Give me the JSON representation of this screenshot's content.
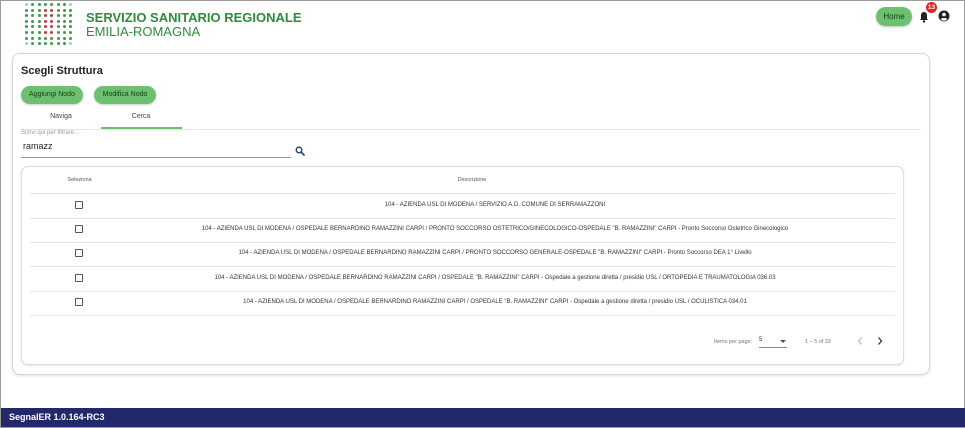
{
  "header": {
    "brand_line1": "SERVIZIO SANITARIO REGIONALE",
    "brand_line2": "EMILIA-ROMAGNA",
    "home_label": "Home",
    "notification_count": "13",
    "colors": {
      "brand": "#2e8b3c",
      "accent": "#6cc070",
      "badge": "#e02424"
    },
    "icons": [
      "bell-icon",
      "account-icon"
    ]
  },
  "card": {
    "title": "Scegli Struttura",
    "buttons": {
      "add_node": "Aggiungi Nodo",
      "edit_node": "Modifica Nodo"
    },
    "tabs": [
      {
        "label": "Naviga",
        "active": false
      },
      {
        "label": "Cerca",
        "active": true
      }
    ],
    "filter": {
      "label": "Scrivi qui per filtrare...",
      "value": "ramazz"
    }
  },
  "table": {
    "headers": {
      "select": "Seleziona",
      "description": "Descrizione"
    },
    "rows": [
      {
        "checked": false,
        "description": "104 - AZIENDA USL DI MODENA / SERVIZIO A.D. COMUNE DI SERRAMAZZONI"
      },
      {
        "checked": false,
        "description": "104 - AZIENDA USL DI MODENA / OSPEDALE BERNARDINO RAMAZZINI CARPI / PRONTO SOCCORSO OSTETRICO/GINECOLOGICO-OSPEDALE \"B. RAMAZZINI\" CARPI - Pronto Soccorso Ostetrico Ginecologico"
      },
      {
        "checked": false,
        "description": "104 - AZIENDA USL DI MODENA / OSPEDALE BERNARDINO RAMAZZINI CARPI / PRONTO SOCCORSO GENERALE-OSPEDALE  \"B. RAMAZZINI\"  CARPI - Pronto Soccorso DEA 1° Livello"
      },
      {
        "checked": false,
        "description": "104 - AZIENDA USL DI MODENA / OSPEDALE BERNARDINO RAMAZZINI CARPI / OSPEDALE \"B. RAMAZZINI\" CARPI - Ospedale a gestione diretta / presidio USL / ORTOPEDIA E TRAUMATOLOGIA 036.03"
      },
      {
        "checked": false,
        "description": "104 - AZIENDA USL DI MODENA / OSPEDALE BERNARDINO RAMAZZINI CARPI / OSPEDALE \"B. RAMAZZINI\" CARPI - Ospedale a gestione diretta / presidio USL / OCULISTICA 034.01"
      }
    ],
    "paginator": {
      "items_per_page_label": "Items per page:",
      "items_per_page_value": "5",
      "range": "1 – 5 of 33"
    }
  },
  "footer": {
    "version": "SegnalER 1.0.164-RC3",
    "color": "#22286a"
  }
}
